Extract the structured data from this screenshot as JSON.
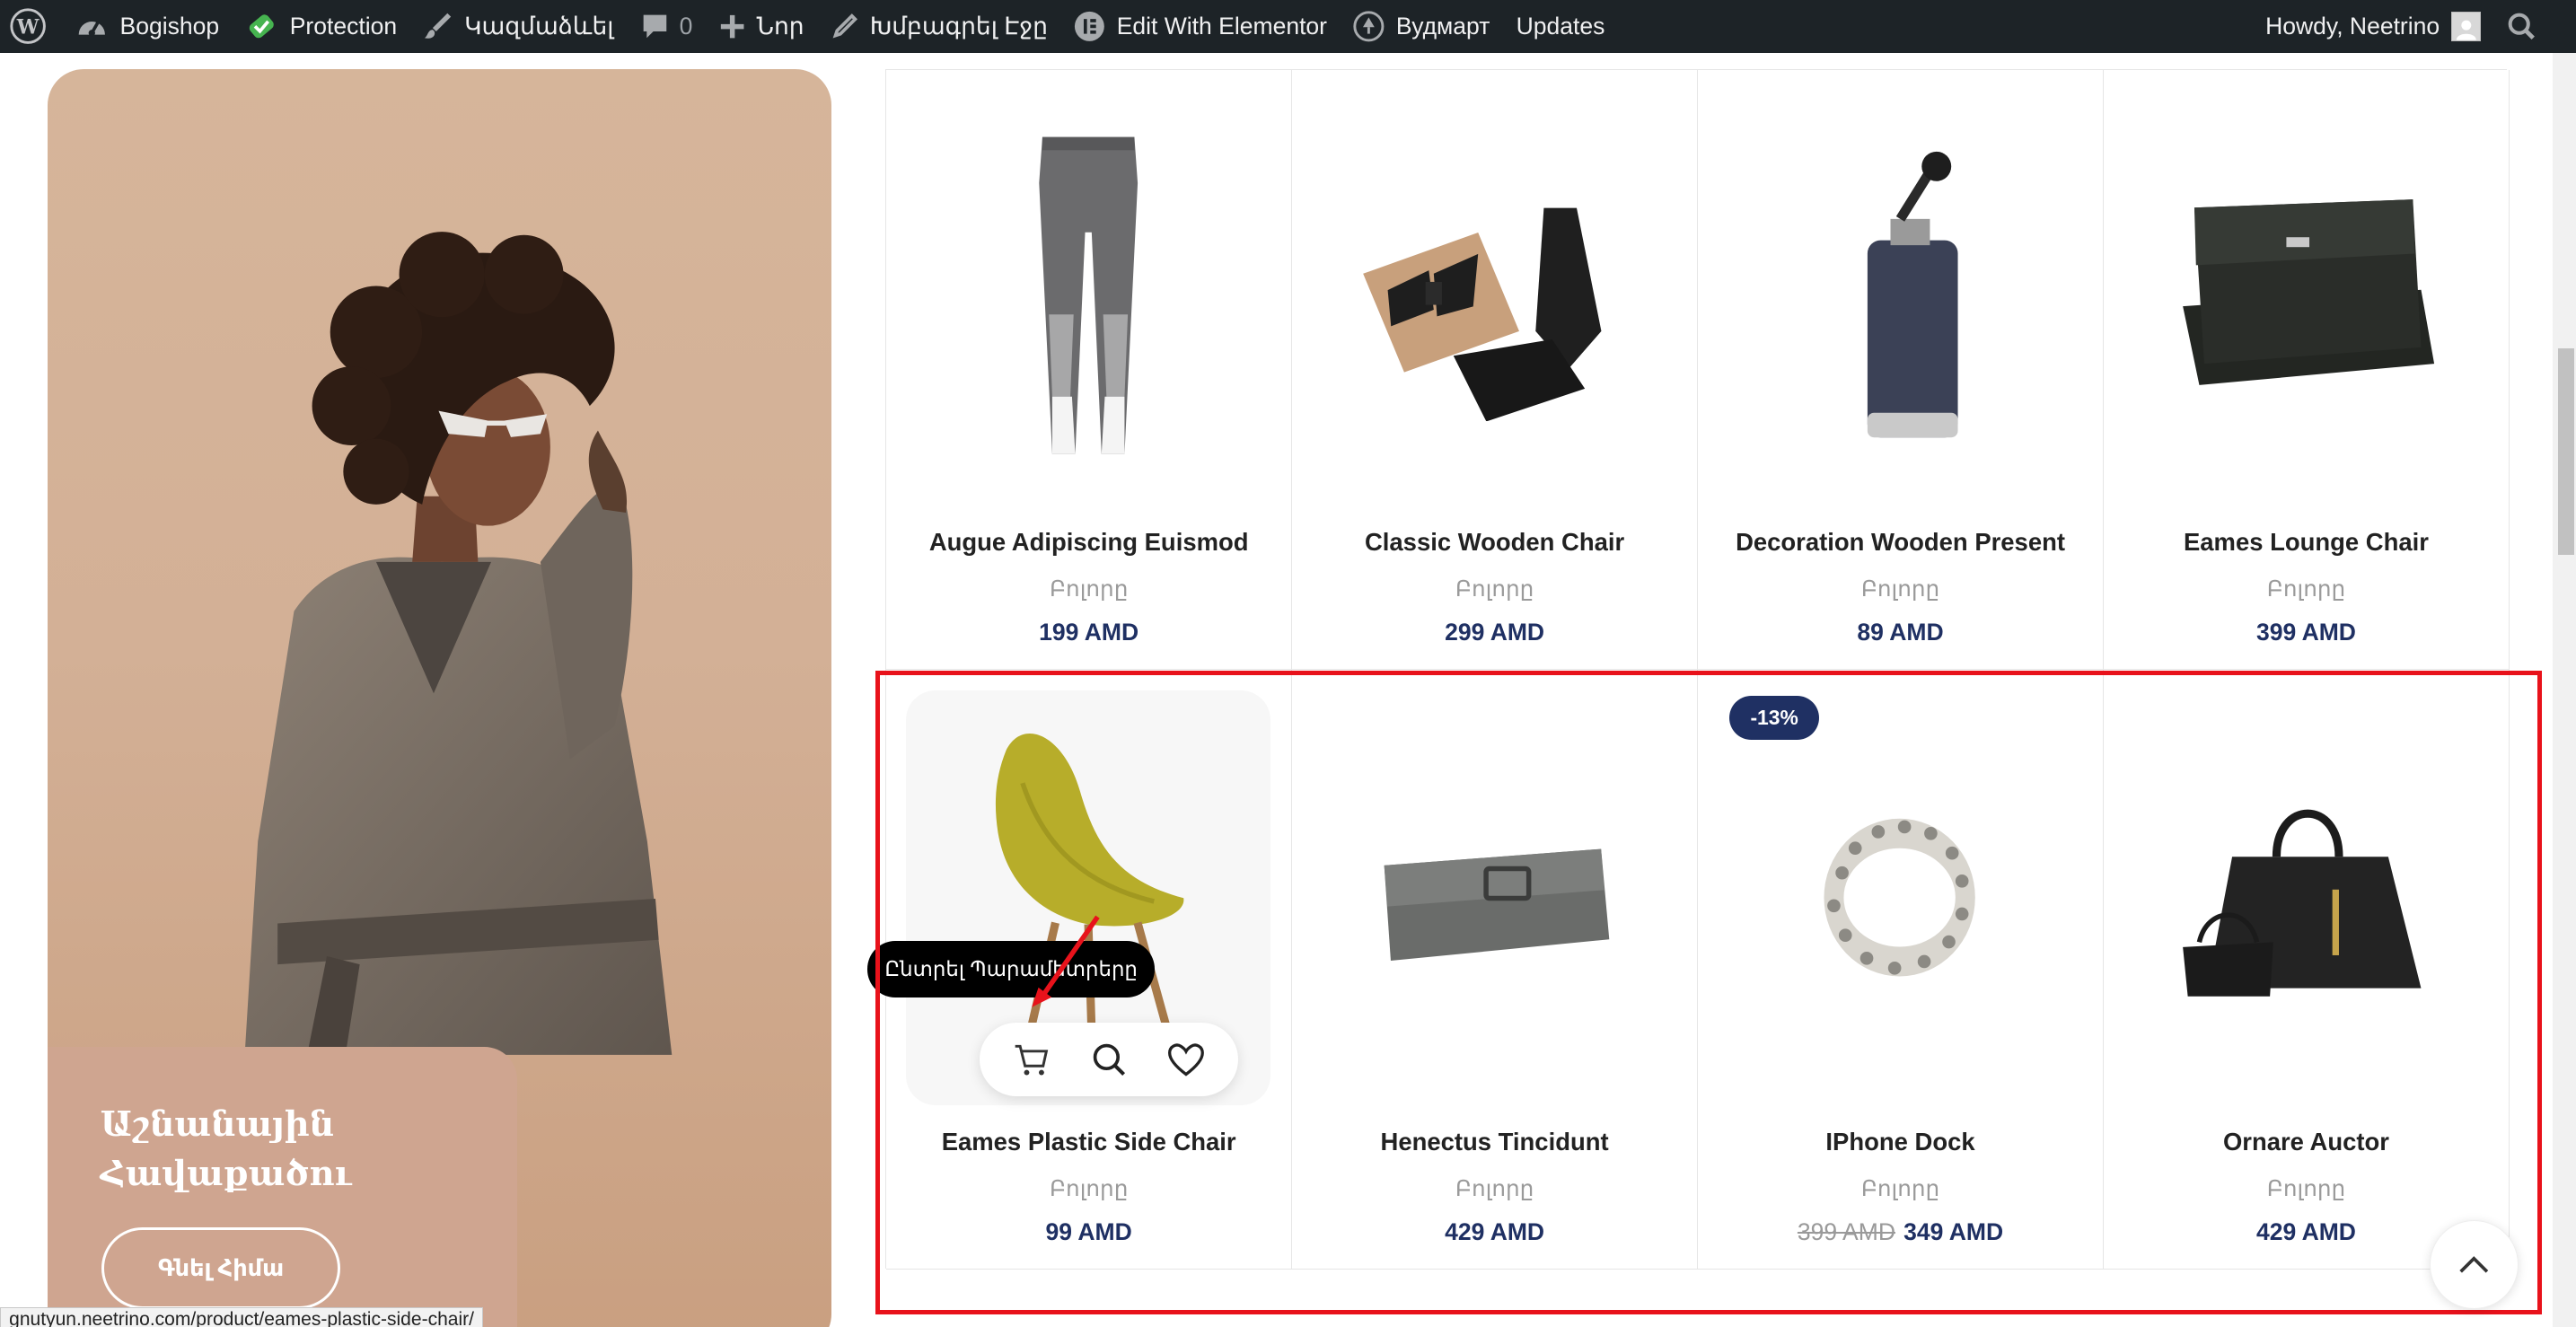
{
  "admin_bar": {
    "site_name": "Bogishop",
    "protection": "Protection",
    "customize": "Կազմաձևել",
    "comments_count": "0",
    "new": "Նոր",
    "edit_page": "Խմբագրել Էջը",
    "edit_elementor": "Edit With Elementor",
    "vudmart": "Вудмарт",
    "updates": "Updates",
    "howdy": "Howdy, Neetrino"
  },
  "banner": {
    "title": "Աշնանային Հավաքածու",
    "button": "Գնել Հիմա"
  },
  "products": [
    {
      "name": "Augue Adipiscing Euismod",
      "category": "Բոլորը",
      "price": "199 AMD",
      "image_icon": "leggings-image"
    },
    {
      "name": "Classic Wooden Chair",
      "category": "Բոլորը",
      "price": "299 AMD",
      "image_icon": "bowtie-set-image"
    },
    {
      "name": "Decoration Wooden Present",
      "category": "Բոլորը",
      "price": "89 AMD",
      "image_icon": "flask-image"
    },
    {
      "name": "Eames Lounge Chair",
      "category": "Բոլորը",
      "price": "399 AMD",
      "image_icon": "wallet-image"
    },
    {
      "name": "Eames Plastic Side Chair",
      "category": "Բոլորը",
      "price": "99 AMD",
      "image_icon": "chair-image"
    },
    {
      "name": "Henectus Tincidunt",
      "category": "Բոլորը",
      "price": "429 AMD",
      "image_icon": "clutch-image"
    },
    {
      "name": "IPhone Dock",
      "category": "Բոլորը",
      "old_price": "399 AMD",
      "price": "349 AMD",
      "badge": "-13%",
      "image_icon": "bracelet-image"
    },
    {
      "name": "Ornare Auctor",
      "category": "Բոլորը",
      "price": "429 AMD",
      "image_icon": "handbag-image"
    }
  ],
  "tooltip": "Ընտրել Պարամետրերը",
  "status_url": "gnutyun.neetrino.com/product/eames-plastic-side-chair/",
  "colors": {
    "price": "#1f3063",
    "badge": "#1f3063",
    "highlight": "#e8121b",
    "admin_bar": "#1d2327"
  }
}
